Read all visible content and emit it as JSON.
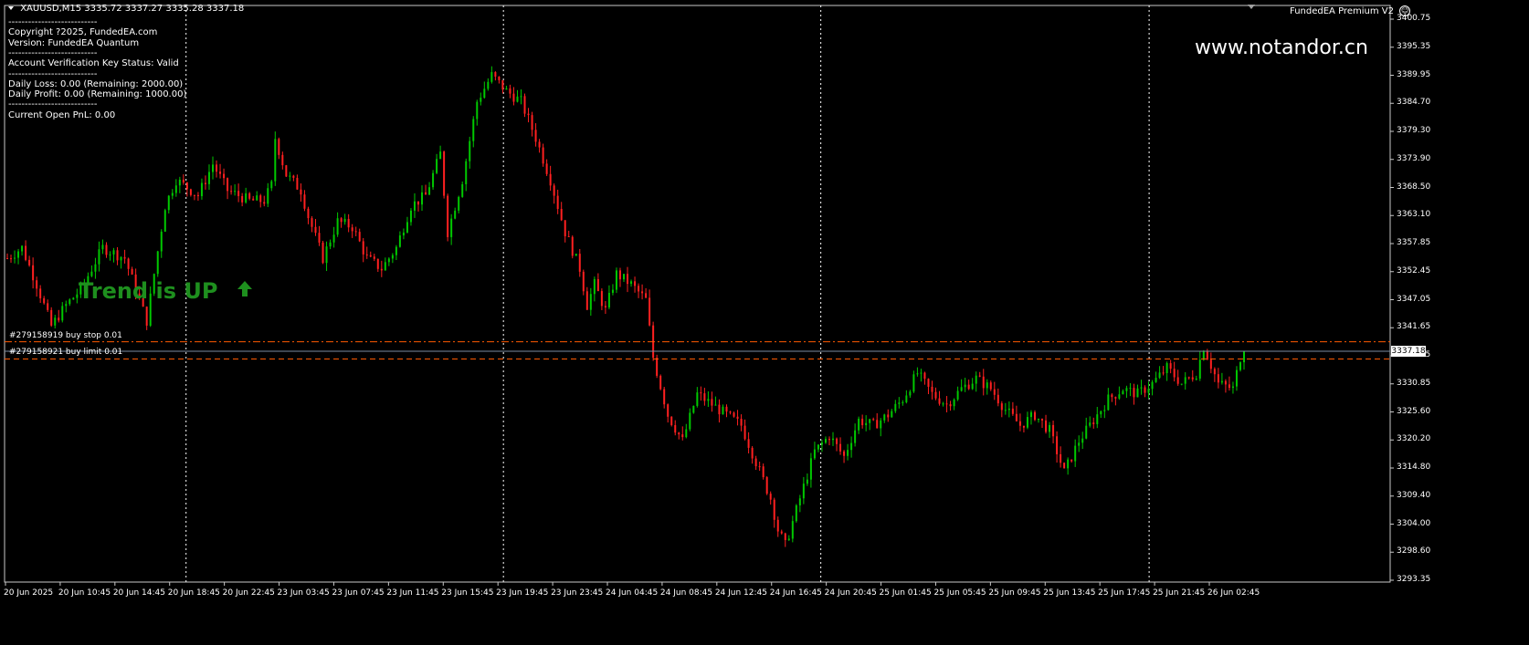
{
  "header": {
    "symbol_line": "XAUUSD,M15  3335.72 3337.27 3335.28 3337.18",
    "ea_name": "FundedEA Premium V2",
    "smiley_glyph": "☺"
  },
  "watermark": "www.notandor.cn",
  "info_panel": [
    "---------------------------",
    "Copyright ?2025, FundedEA.com",
    "Version: FundedEA Quantum",
    "---------------------------",
    "Account Verification Key Status: Valid",
    "---------------------------",
    "Daily Loss: 0.00 (Remaining: 2000.00)",
    "Daily Profit: 0.00 (Remaining: 1000.00)",
    "---------------------------",
    "Current Open PnL: 0.00"
  ],
  "trend": {
    "text": "Trend is UP",
    "arrow": "🡅",
    "color": "#1e8f1e"
  },
  "orders": [
    {
      "label": "#279158919 buy stop 0.01",
      "price": 3339.0
    },
    {
      "label": "#279158921 buy limit 0.01",
      "price": 3335.7
    }
  ],
  "bid_price": "3337.18",
  "colors": {
    "bull": "#00c800",
    "bear": "#ff2020",
    "order_line": "#ff5a00",
    "bid_line": "#7a8ca0",
    "grid": "#ffffff"
  },
  "price_axis": [
    "3400.75",
    "3395.35",
    "3389.95",
    "3384.70",
    "3379.30",
    "3373.90",
    "3368.50",
    "3363.10",
    "3357.85",
    "3352.45",
    "3347.05",
    "3341.65",
    "3336.25",
    "3330.85",
    "3325.60",
    "3320.20",
    "3314.80",
    "3309.40",
    "3304.00",
    "3298.60",
    "3293.35"
  ],
  "time_axis": [
    "20 Jun 2025",
    "20 Jun 10:45",
    "20 Jun 14:45",
    "20 Jun 18:45",
    "20 Jun 22:45",
    "23 Jun 03:45",
    "23 Jun 07:45",
    "23 Jun 11:45",
    "23 Jun 15:45",
    "23 Jun 19:45",
    "23 Jun 23:45",
    "24 Jun 04:45",
    "24 Jun 08:45",
    "24 Jun 12:45",
    "24 Jun 16:45",
    "24 Jun 20:45",
    "25 Jun 01:45",
    "25 Jun 05:45",
    "25 Jun 09:45",
    "25 Jun 13:45",
    "25 Jun 17:45",
    "25 Jun 21:45",
    "26 Jun 02:45"
  ],
  "chart_data": {
    "type": "candlestick",
    "symbol": "XAUUSD",
    "timeframe": "M15",
    "ylim": [
      3293.35,
      3400.75
    ],
    "day_separators_after_label_index": [
      3.3,
      9.1,
      14.9,
      20.9
    ],
    "path_points": [
      [
        0,
        3355
      ],
      [
        4,
        3357
      ],
      [
        8,
        3350
      ],
      [
        12,
        3342
      ],
      [
        16,
        3346
      ],
      [
        20,
        3349
      ],
      [
        26,
        3357
      ],
      [
        32,
        3355
      ],
      [
        36,
        3347
      ],
      [
        38,
        3343
      ],
      [
        40,
        3352
      ],
      [
        43,
        3365
      ],
      [
        46,
        3370
      ],
      [
        52,
        3367
      ],
      [
        56,
        3373
      ],
      [
        60,
        3368
      ],
      [
        66,
        3366
      ],
      [
        70,
        3366
      ],
      [
        72,
        3369
      ],
      [
        73,
        3378
      ],
      [
        76,
        3371
      ],
      [
        80,
        3368
      ],
      [
        82,
        3363
      ],
      [
        86,
        3355
      ],
      [
        90,
        3362
      ],
      [
        94,
        3361
      ],
      [
        98,
        3355
      ],
      [
        102,
        3353
      ],
      [
        106,
        3357
      ],
      [
        110,
        3365
      ],
      [
        114,
        3367
      ],
      [
        118,
        3375
      ],
      [
        120,
        3360
      ],
      [
        124,
        3370
      ],
      [
        128,
        3385
      ],
      [
        132,
        3390
      ],
      [
        136,
        3387
      ],
      [
        140,
        3385
      ],
      [
        144,
        3378
      ],
      [
        148,
        3370
      ],
      [
        152,
        3360
      ],
      [
        156,
        3353
      ],
      [
        158,
        3346
      ],
      [
        160,
        3350
      ],
      [
        163,
        3345
      ],
      [
        166,
        3352
      ],
      [
        170,
        3350
      ],
      [
        174,
        3347
      ],
      [
        176,
        3336
      ],
      [
        180,
        3325
      ],
      [
        184,
        3320
      ],
      [
        188,
        3329
      ],
      [
        192,
        3327
      ],
      [
        196,
        3325
      ],
      [
        200,
        3323
      ],
      [
        204,
        3316
      ],
      [
        208,
        3309
      ],
      [
        210,
        3303
      ],
      [
        212,
        3300
      ],
      [
        216,
        3309
      ],
      [
        220,
        3318
      ],
      [
        224,
        3321
      ],
      [
        228,
        3317
      ],
      [
        232,
        3324
      ],
      [
        236,
        3323
      ],
      [
        240,
        3325
      ],
      [
        244,
        3328
      ],
      [
        248,
        3333
      ],
      [
        252,
        3329
      ],
      [
        256,
        3327
      ],
      [
        260,
        3330
      ],
      [
        264,
        3332
      ],
      [
        268,
        3330
      ],
      [
        272,
        3326
      ],
      [
        276,
        3323
      ],
      [
        280,
        3325
      ],
      [
        284,
        3322
      ],
      [
        288,
        3314
      ],
      [
        292,
        3320
      ],
      [
        296,
        3324
      ],
      [
        300,
        3328
      ],
      [
        304,
        3330
      ],
      [
        308,
        3329
      ],
      [
        312,
        3331
      ],
      [
        316,
        3334
      ],
      [
        320,
        3331
      ],
      [
        324,
        3333
      ],
      [
        326,
        3338
      ],
      [
        330,
        3331
      ],
      [
        334,
        3330
      ],
      [
        336,
        3336
      ],
      [
        337,
        3337.18
      ]
    ]
  }
}
